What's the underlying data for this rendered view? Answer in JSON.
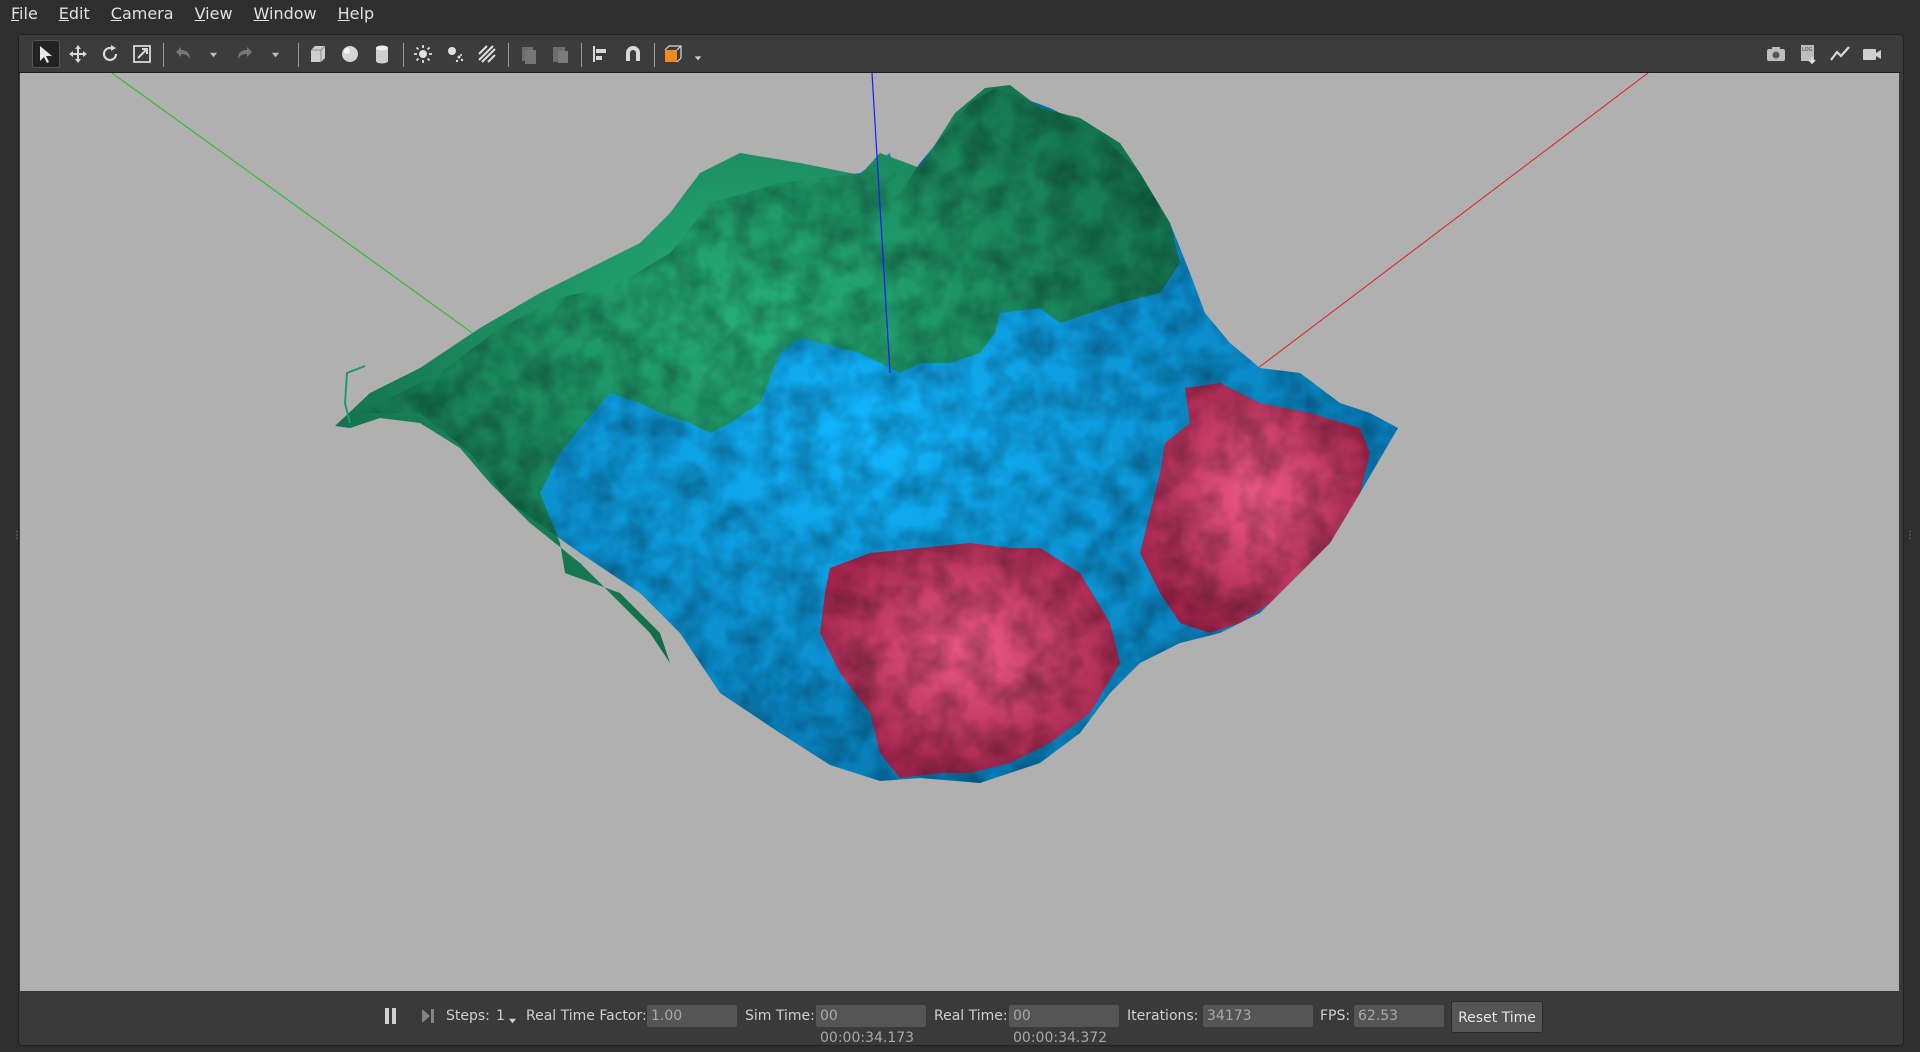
{
  "menu": {
    "items": [
      {
        "mnemonic": "F",
        "rest": "ile"
      },
      {
        "mnemonic": "E",
        "rest": "dit"
      },
      {
        "mnemonic": "C",
        "rest": "amera"
      },
      {
        "mnemonic": "V",
        "rest": "iew"
      },
      {
        "mnemonic": "W",
        "rest": "indow"
      },
      {
        "mnemonic": "H",
        "rest": "elp"
      }
    ]
  },
  "toolbar": {
    "left_icons": [
      "select-arrow-icon",
      "translate-icon",
      "rotate-icon",
      "scale-icon",
      "undo-icon",
      "redo-icon",
      "box-shape-icon",
      "sphere-shape-icon",
      "cylinder-shape-icon",
      "point-light-icon",
      "spot-light-icon",
      "directional-light-icon",
      "copy-icon",
      "paste-icon",
      "align-icon",
      "magnet-icon",
      "view-angle-icon"
    ],
    "right_icons": [
      "screenshot-icon",
      "log-icon",
      "plot-icon",
      "video-record-icon"
    ],
    "right_badge": "LOG"
  },
  "colors": {
    "viewport_bg": "#b0b0b0",
    "terrain_green": "#1f9a6a",
    "terrain_blue": "#0aa6e8",
    "terrain_red": "#e04a78",
    "axis_x": "#e02020",
    "axis_y": "#20c020",
    "axis_z": "#1a1aff",
    "accent_orange": "#f08a20"
  },
  "status": {
    "steps_label": "Steps:",
    "steps_value": "1",
    "rtf_label": "Real Time Factor:",
    "rtf_value": "1.00",
    "sim_time_label": "Sim Time:",
    "sim_time_value": "00 00:00:34.173",
    "real_time_label": "Real Time:",
    "real_time_value": "00 00:00:34.372",
    "iterations_label": "Iterations:",
    "iterations_value": "34173",
    "fps_label": "FPS:",
    "fps_value": "62.53",
    "reset_button": "Reset Time"
  }
}
